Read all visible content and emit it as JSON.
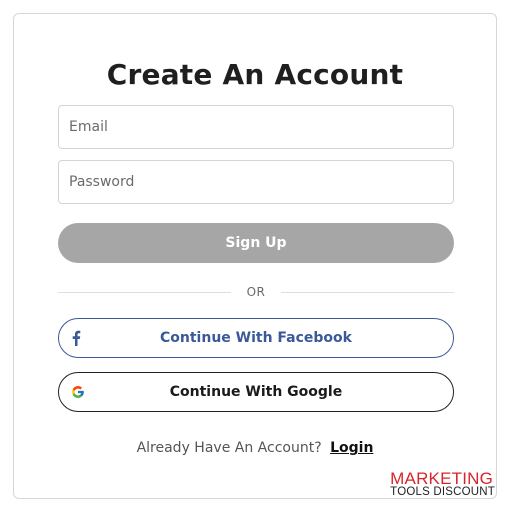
{
  "form": {
    "title": "Create An Account",
    "email_placeholder": "Email",
    "password_placeholder": "Password",
    "signup_label": "Sign Up",
    "or_label": "OR",
    "facebook_label": "Continue With Facebook",
    "google_label": "Continue With Google",
    "already_text": "Already Have An Account?",
    "login_label": "Login"
  },
  "watermark": {
    "line1": "MARKETING",
    "line2": "TOOLS DISCOUNT"
  },
  "colors": {
    "signup_bg": "#a6a6a6",
    "facebook": "#3b5998",
    "watermark_red": "#d7262b"
  },
  "icons": {
    "facebook": "facebook-icon",
    "google": "google-icon"
  }
}
